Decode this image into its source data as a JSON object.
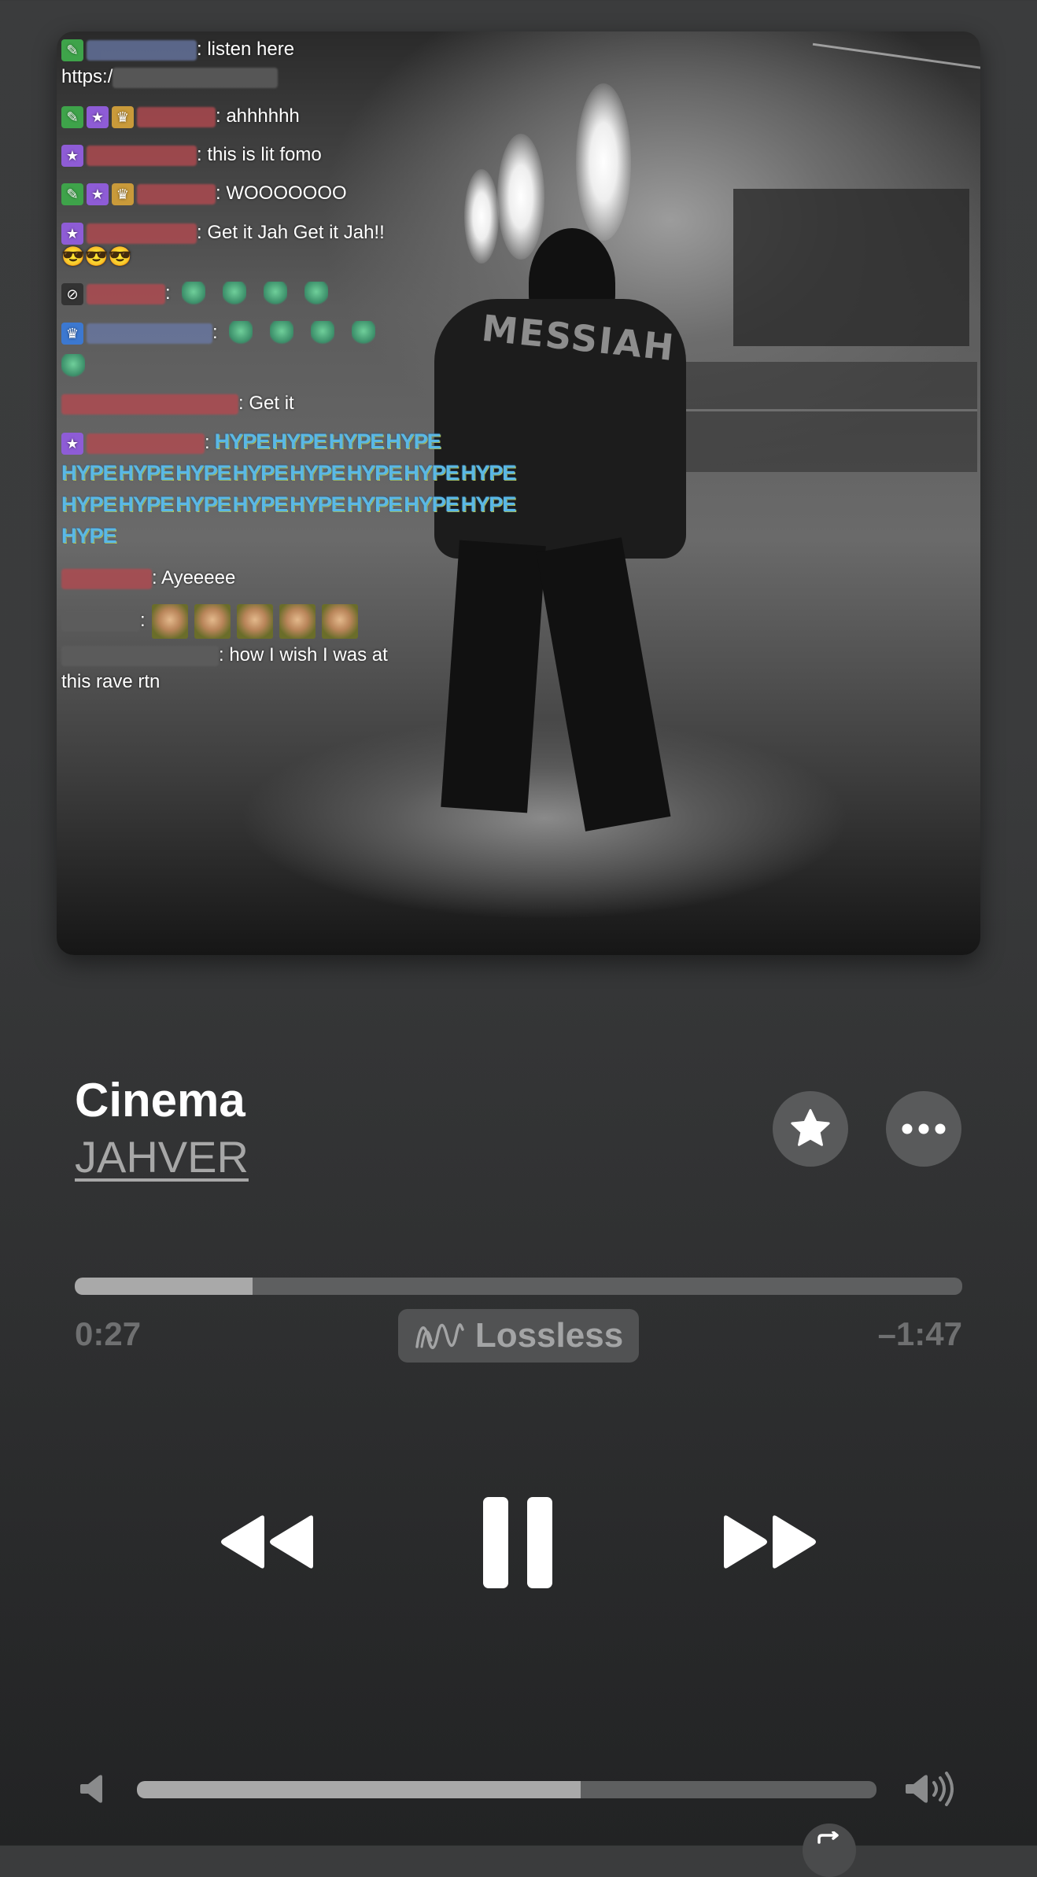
{
  "chat": {
    "messages": [
      {
        "text": ": listen here"
      },
      {
        "text": "https:/"
      },
      {
        "text": ": ahhhhhh"
      },
      {
        "text": ": this is lit fomo"
      },
      {
        "text": ": WOOOOOOO"
      },
      {
        "text": ": Get it Jah Get it Jah!!"
      },
      {
        "text": "😎😎😎"
      },
      {
        "text": ":"
      },
      {
        "text": ":"
      },
      {
        "text": ": Get it"
      },
      {
        "text": ":"
      },
      {
        "text": ": Ayeeeee"
      },
      {
        "text": ":"
      },
      {
        "text": ": how I wish I was at"
      },
      {
        "text": "this rave rtn"
      }
    ],
    "hype_word": "HYPE"
  },
  "artwork": {
    "hoodie_text": "MESSIAH"
  },
  "track": {
    "title": "Cinema",
    "artist": "JAHVER"
  },
  "playback": {
    "elapsed": "0:27",
    "remaining": "–1:47",
    "progress_fraction": 0.2,
    "quality_label": "Lossless"
  },
  "volume": {
    "level_fraction": 0.6
  },
  "colors": {
    "progress_fill": "#a9a9a9",
    "track_bg": "#5e5f60",
    "accent_text": "#a7a7a7"
  },
  "icons": [
    "star-icon",
    "more-icon",
    "rewind-icon",
    "pause-icon",
    "fast-forward-icon",
    "volume-low-icon",
    "volume-high-icon",
    "repeat-icon",
    "lossless-icon"
  ]
}
